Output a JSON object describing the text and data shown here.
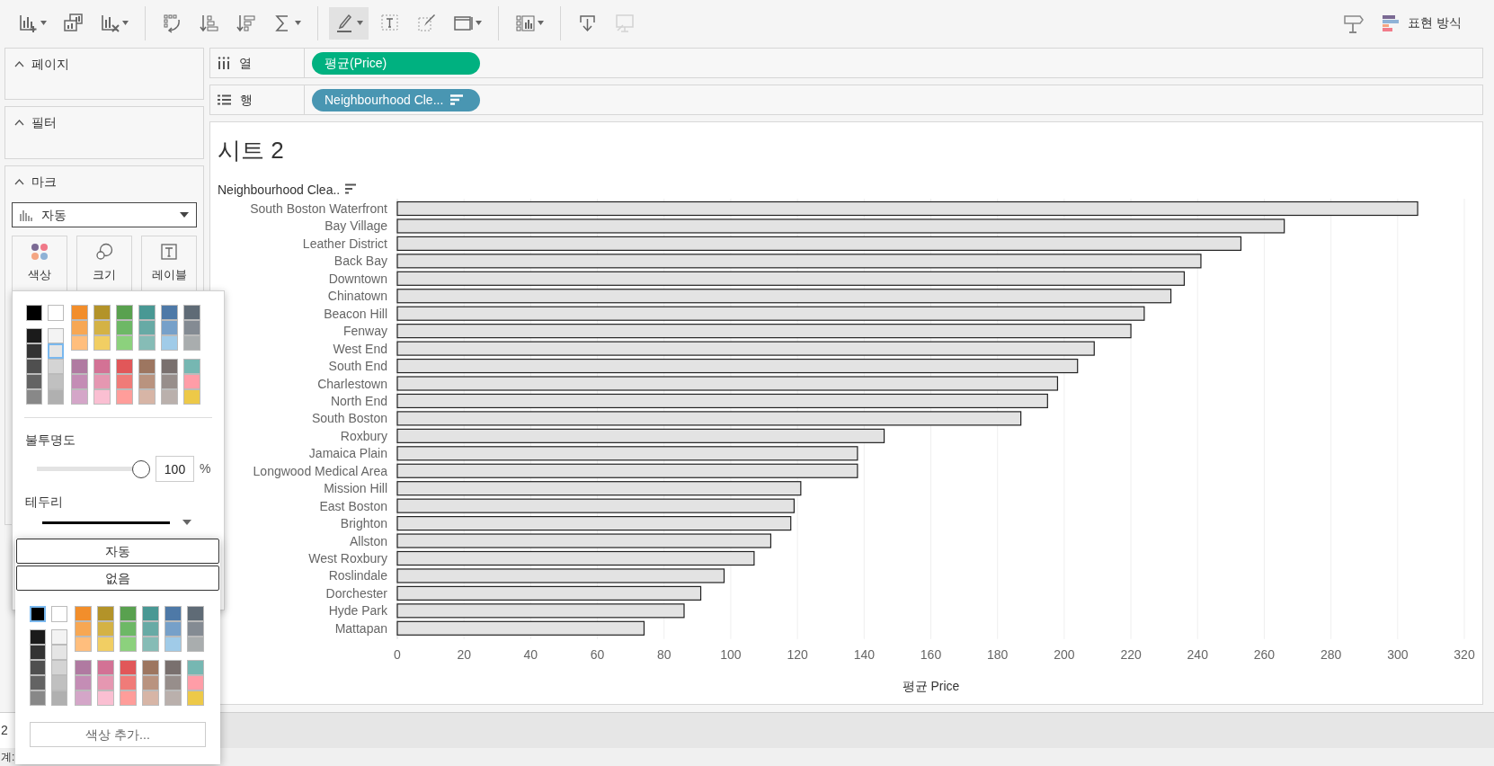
{
  "toolbar": {
    "groups": [
      [
        {
          "kind": "add-chart",
          "active": false,
          "disabled": false
        },
        {
          "kind": "duplicate",
          "active": false,
          "disabled": false
        },
        {
          "kind": "clear",
          "active": false,
          "disabled": false
        }
      ],
      [
        {
          "kind": "swap",
          "active": false,
          "disabled": false
        },
        {
          "kind": "sort-asc",
          "active": false,
          "disabled": false
        },
        {
          "kind": "sort-desc",
          "active": false,
          "disabled": false
        },
        {
          "kind": "sigma",
          "active": false,
          "disabled": false
        }
      ],
      [
        {
          "kind": "highlight",
          "active": true,
          "disabled": false
        },
        {
          "kind": "text",
          "active": false,
          "disabled": false
        },
        {
          "kind": "annotate",
          "active": false,
          "disabled": false
        },
        {
          "kind": "fit",
          "active": false,
          "disabled": false
        }
      ],
      [
        {
          "kind": "cards",
          "active": false,
          "disabled": false
        }
      ],
      [
        {
          "kind": "download",
          "active": false,
          "disabled": false
        },
        {
          "kind": "present",
          "active": false,
          "disabled": true
        }
      ]
    ],
    "show_me": {
      "label": "표현 방식"
    }
  },
  "left_panel": {
    "pages": {
      "title": "페이지",
      "expanded": true
    },
    "filters": {
      "title": "필터",
      "expanded": true
    },
    "marks": {
      "title": "마크",
      "expanded": true,
      "mark_type": "자동",
      "cards": [
        {
          "kind": "color",
          "label": "색상"
        },
        {
          "kind": "size",
          "label": "크기"
        },
        {
          "kind": "label",
          "label": "레이블"
        }
      ]
    }
  },
  "shelves": [
    {
      "kind": "columns",
      "label": "열",
      "pill": {
        "text": "평균(Price)",
        "kind": "measure",
        "sorted": false
      }
    },
    {
      "kind": "rows",
      "label": "행",
      "pill": {
        "text": "Neighbourhood Cle...",
        "kind": "dimension",
        "sorted": true
      }
    }
  ],
  "sheet": {
    "title": "시트 2",
    "header": "Neighbourhood Clea..",
    "header_sorted": true,
    "chart_data": {
      "type": "bar",
      "orientation": "horizontal",
      "xlabel": "평균 Price",
      "categories": [
        "South Boston Waterfront",
        "Bay Village",
        "Leather District",
        "Back Bay",
        "Downtown",
        "Chinatown",
        "Beacon Hill",
        "Fenway",
        "West End",
        "South End",
        "Charlestown",
        "North End",
        "South Boston",
        "Roxbury",
        "Jamaica Plain",
        "Longwood Medical Area",
        "Mission Hill",
        "East Boston",
        "Brighton",
        "Allston",
        "West Roxbury",
        "Roslindale",
        "Dorchester",
        "Hyde Park",
        "Mattapan"
      ],
      "values": [
        306,
        266,
        253,
        241,
        236,
        232,
        224,
        220,
        209,
        204,
        198,
        195,
        187,
        146,
        138,
        138,
        121,
        119,
        118,
        112,
        107,
        98,
        91,
        86,
        74
      ],
      "xlim": [
        0,
        320
      ],
      "grid": true,
      "xticks": [
        0,
        20,
        40,
        60,
        80,
        100,
        120,
        140,
        160,
        180,
        200,
        220,
        240,
        260,
        280,
        300,
        320
      ]
    }
  },
  "color_popup": {
    "swatches": [
      {
        "color": "#000000",
        "selected": false
      },
      {
        "color": "#ffffff",
        "selected": false
      },
      {
        "color": "#1b1b1b",
        "selected": false
      },
      {
        "color": "#333333",
        "selected": false
      },
      {
        "color": "#4f4f4f",
        "selected": false
      },
      {
        "color": "#636363",
        "selected": false
      },
      {
        "color": "#888888",
        "selected": false
      },
      {
        "color": "#f3f3f3",
        "selected": false
      },
      {
        "color": "#e5e5e5",
        "selected": true
      },
      {
        "color": "#d4d4d4",
        "selected": false
      },
      {
        "color": "#c0c0c0",
        "selected": false
      },
      {
        "color": "#b0b0b0",
        "selected": false
      },
      {
        "color": "#f28e2b",
        "selected": false
      },
      {
        "color": "#f7a753",
        "selected": false
      },
      {
        "color": "#ffbe7d",
        "selected": false
      },
      {
        "color": "#b39329",
        "selected": false
      },
      {
        "color": "#d4b245",
        "selected": false
      },
      {
        "color": "#f1ce63",
        "selected": false
      },
      {
        "color": "#59a14f",
        "selected": false
      },
      {
        "color": "#6db866",
        "selected": false
      },
      {
        "color": "#8cd17d",
        "selected": false
      },
      {
        "color": "#499894",
        "selected": false
      },
      {
        "color": "#67aaa5",
        "selected": false
      },
      {
        "color": "#86bcb6",
        "selected": false
      },
      {
        "color": "#4e79a7",
        "selected": false
      },
      {
        "color": "#76a0c9",
        "selected": false
      },
      {
        "color": "#a0cbe8",
        "selected": false
      },
      {
        "color": "#5f6b76",
        "selected": false
      },
      {
        "color": "#848b93",
        "selected": false
      },
      {
        "color": "#a9adae",
        "selected": false
      },
      {
        "color": "#b07aa1",
        "selected": false
      },
      {
        "color": "#c48db5",
        "selected": false
      },
      {
        "color": "#d4a6c8",
        "selected": false
      },
      {
        "color": "#d37295",
        "selected": false
      },
      {
        "color": "#e597b1",
        "selected": false
      },
      {
        "color": "#fabfd2",
        "selected": false
      },
      {
        "color": "#e15759",
        "selected": false
      },
      {
        "color": "#f07b78",
        "selected": false
      },
      {
        "color": "#ff9d9a",
        "selected": false
      },
      {
        "color": "#9d7660",
        "selected": false
      },
      {
        "color": "#b9937f",
        "selected": false
      },
      {
        "color": "#d7b5a6",
        "selected": false
      },
      {
        "color": "#79706e",
        "selected": false
      },
      {
        "color": "#978e8b",
        "selected": false
      },
      {
        "color": "#bab0ac",
        "selected": false
      },
      {
        "color": "#76b7b2",
        "selected": false
      },
      {
        "color": "#ff9da7",
        "selected": false
      },
      {
        "color": "#edc948",
        "selected": false
      }
    ],
    "opacity": {
      "label": "불투명도",
      "level": 1,
      "value": "100",
      "unit": "%"
    },
    "border": {
      "label": "테두리"
    }
  },
  "border_popup": {
    "buttons": [
      "자동",
      "없음"
    ],
    "swatches": [
      {
        "color": "#000000",
        "selected": true
      },
      {
        "color": "#ffffff",
        "selected": false
      },
      {
        "color": "#1b1b1b",
        "selected": false
      },
      {
        "color": "#333333",
        "selected": false
      },
      {
        "color": "#4f4f4f",
        "selected": false
      },
      {
        "color": "#636363",
        "selected": false
      },
      {
        "color": "#888888",
        "selected": false
      },
      {
        "color": "#f3f3f3",
        "selected": false
      },
      {
        "color": "#e5e5e5",
        "selected": false
      },
      {
        "color": "#d4d4d4",
        "selected": false
      },
      {
        "color": "#c0c0c0",
        "selected": false
      },
      {
        "color": "#b0b0b0",
        "selected": false
      },
      {
        "color": "#f28e2b",
        "selected": false
      },
      {
        "color": "#f7a753",
        "selected": false
      },
      {
        "color": "#ffbe7d",
        "selected": false
      },
      {
        "color": "#b39329",
        "selected": false
      },
      {
        "color": "#d4b245",
        "selected": false
      },
      {
        "color": "#f1ce63",
        "selected": false
      },
      {
        "color": "#59a14f",
        "selected": false
      },
      {
        "color": "#6db866",
        "selected": false
      },
      {
        "color": "#8cd17d",
        "selected": false
      },
      {
        "color": "#499894",
        "selected": false
      },
      {
        "color": "#67aaa5",
        "selected": false
      },
      {
        "color": "#86bcb6",
        "selected": false
      },
      {
        "color": "#4e79a7",
        "selected": false
      },
      {
        "color": "#76a0c9",
        "selected": false
      },
      {
        "color": "#a0cbe8",
        "selected": false
      },
      {
        "color": "#5f6b76",
        "selected": false
      },
      {
        "color": "#848b93",
        "selected": false
      },
      {
        "color": "#a9adae",
        "selected": false
      },
      {
        "color": "#b07aa1",
        "selected": false
      },
      {
        "color": "#c48db5",
        "selected": false
      },
      {
        "color": "#d4a6c8",
        "selected": false
      },
      {
        "color": "#d37295",
        "selected": false
      },
      {
        "color": "#e597b1",
        "selected": false
      },
      {
        "color": "#fabfd2",
        "selected": false
      },
      {
        "color": "#e15759",
        "selected": false
      },
      {
        "color": "#f07b78",
        "selected": false
      },
      {
        "color": "#ff9d9a",
        "selected": false
      },
      {
        "color": "#9d7660",
        "selected": false
      },
      {
        "color": "#b9937f",
        "selected": false
      },
      {
        "color": "#d7b5a6",
        "selected": false
      },
      {
        "color": "#79706e",
        "selected": false
      },
      {
        "color": "#978e8b",
        "selected": false
      },
      {
        "color": "#bab0ac",
        "selected": false
      },
      {
        "color": "#76b7b2",
        "selected": false
      },
      {
        "color": "#ff9da7",
        "selected": false
      },
      {
        "color": "#edc948",
        "selected": false
      }
    ],
    "more_button": "색상 추가..."
  },
  "sheet_tabs": [
    {
      "label": "2",
      "selected": true
    }
  ],
  "status_bar": {
    "text": "계:"
  }
}
